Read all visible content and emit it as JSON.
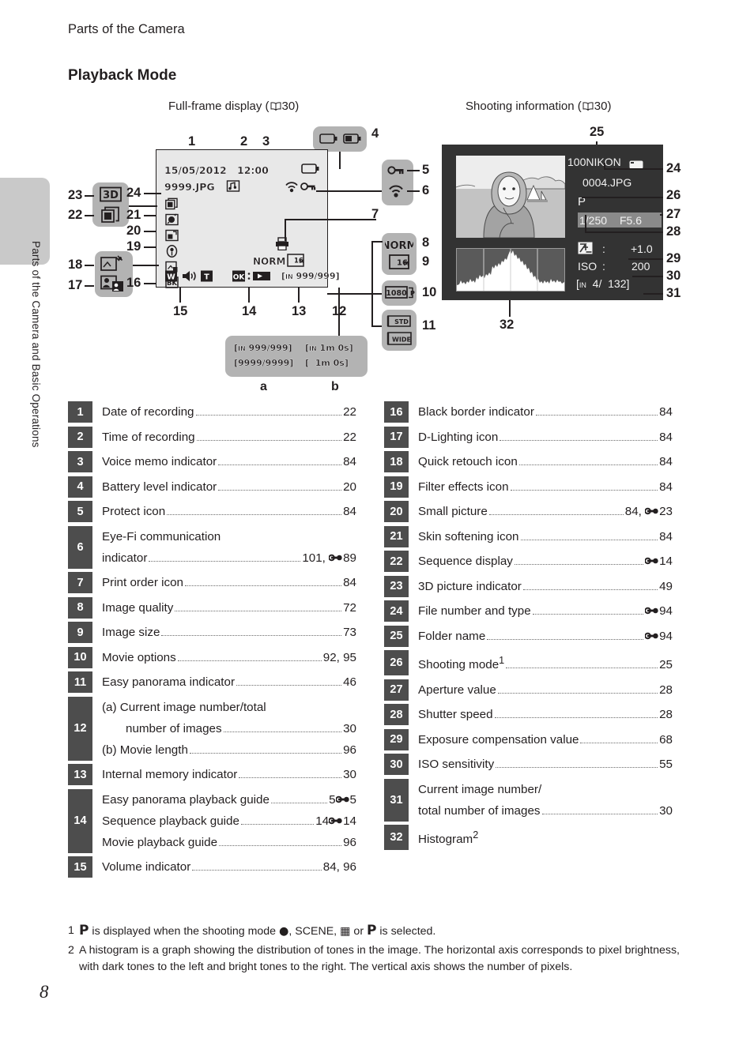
{
  "running_title": "Parts of the Camera",
  "section_title": "Playback Mode",
  "side_running_head": "Parts of the Camera and Basic Operations",
  "page_number": "8",
  "captions": {
    "left_pre": "Full-frame display (",
    "left_ref": "30",
    "left_post": ")",
    "right_pre": "Shooting information (",
    "right_ref": "30",
    "right_post": ")"
  },
  "full_frame_lcd": {
    "date": "15/05/2012",
    "time": "12:00",
    "filename": "9999.JPG",
    "voice_memo_icon": "voice-memo-icon",
    "battery_icon": "battery-full-icon",
    "eyefi_icon": "eye-fi-icon",
    "protect_icon": "protect-key-icon",
    "print_order_icon": "print-order-icon",
    "quality_label": "NORM",
    "quality_size_icon": "image-size-16m-icon",
    "volume_w": "W",
    "volume_t": "T",
    "volume_icon": "speaker-icon",
    "ok_label": "OK",
    "ok_sep": ":",
    "play_icon": "play-icon",
    "frame_counter": "[ᴵᴺ 999/999]",
    "frame_counter_text": "999/999",
    "internal_mark": "IN"
  },
  "callout_clusters": {
    "battery": {
      "icons": [
        "battery-empty-icon",
        "battery-half-icon"
      ]
    },
    "protect_eyefi": {
      "icons": [
        "protect-key-icon",
        "eye-fi-icon"
      ]
    },
    "quality": {
      "label": "NORM",
      "size_icon": "image-size-16m-icon"
    },
    "movie": {
      "label": "1080",
      "suffix": "P"
    },
    "panorama": {
      "std": "STD",
      "wide": "WIDE"
    },
    "three_d": {
      "label": "3D"
    },
    "sequence": {
      "icon": "sequence-display-icon"
    },
    "quick_retouch": {
      "icon": "quick-retouch-icon"
    },
    "d_lighting": {
      "icon": "d-lighting-icon"
    }
  },
  "lcd_left_icons": [
    {
      "num": "24",
      "name": "file-number-and-type"
    },
    {
      "num": "22",
      "name": "sequence-display-icon"
    },
    {
      "num": "21",
      "name": "skin-softening-icon"
    },
    {
      "num": "20",
      "name": "small-picture-icon"
    },
    {
      "num": "19",
      "name": "filter-effects-icon"
    },
    {
      "num": "18",
      "name": "quick-retouch-icon"
    },
    {
      "num": "16",
      "name": "black-border-icon"
    }
  ],
  "figure_numbers": [
    "1",
    "2",
    "3",
    "4",
    "5",
    "6",
    "7",
    "8",
    "9",
    "10",
    "11",
    "12",
    "13",
    "14",
    "15",
    "16",
    "17",
    "18",
    "19",
    "20",
    "21",
    "22",
    "23",
    "24",
    "25",
    "26",
    "27",
    "28",
    "29",
    "30",
    "31",
    "32"
  ],
  "ab_box": {
    "line1_left": "[ᴵᴺ 999/999]",
    "line1_right": "[ᴵᴺ 1m 0s]",
    "line2_left": "[9999/9999]",
    "line2_right": "[ 1m 0s]",
    "l1l": "999/999",
    "l1r": "1m 0s",
    "l2l": "9999/9999",
    "l2r": "1m 0s",
    "label_a": "a",
    "label_b": "b"
  },
  "shooting_info": {
    "folder_name": "100NIKON",
    "card_icon": "memory-card-icon",
    "file_name": "0004.JPG",
    "shooting_mode": "P",
    "shutter_speed": "1/250",
    "aperture": "F5.6",
    "exposure_comp_label": "exposure-compensation-icon",
    "exposure_comp_sep": ":",
    "exposure_comp_value": "+1.0",
    "iso_label": "ISO",
    "iso_sep": ":",
    "iso_value": "200",
    "counter": "[ᴵᴺ 4/ 132]",
    "counter_internal": "IN",
    "counter_current": "4/",
    "counter_total": "132]",
    "counter_open": "["
  },
  "list_left": [
    {
      "num": "1",
      "lines": [
        {
          "text": "Date of recording",
          "page": "22"
        }
      ]
    },
    {
      "num": "2",
      "lines": [
        {
          "text": "Time of recording",
          "page": "22"
        }
      ]
    },
    {
      "num": "3",
      "lines": [
        {
          "text": "Voice memo indicator",
          "page": "84"
        }
      ]
    },
    {
      "num": "4",
      "lines": [
        {
          "text": "Battery level indicator",
          "page": "20"
        }
      ]
    },
    {
      "num": "5",
      "lines": [
        {
          "text": "Protect icon",
          "page": "84"
        }
      ]
    },
    {
      "num": "6",
      "lines": [
        {
          "text": "Eye-Fi communication",
          "plain": true
        },
        {
          "text": "indicator",
          "page": "101, ",
          "eref": "89"
        }
      ]
    },
    {
      "num": "7",
      "lines": [
        {
          "text": "Print order icon",
          "page": "84"
        }
      ]
    },
    {
      "num": "8",
      "lines": [
        {
          "text": "Image quality",
          "page": "72"
        }
      ]
    },
    {
      "num": "9",
      "lines": [
        {
          "text": "Image size",
          "page": "73"
        }
      ]
    },
    {
      "num": "10",
      "lines": [
        {
          "text": "Movie options",
          "page": "92, 95"
        }
      ]
    },
    {
      "num": "11",
      "lines": [
        {
          "text": "Easy panorama indicator",
          "page": "46"
        }
      ]
    },
    {
      "num": "12",
      "lines": [
        {
          "text": "(a) Current image number/total",
          "plain": true
        },
        {
          "text": "number of images",
          "page": "30",
          "indent": true
        },
        {
          "text": "(b) Movie length",
          "page": "96"
        }
      ]
    },
    {
      "num": "13",
      "lines": [
        {
          "text": "Internal memory indicator",
          "page": "30"
        }
      ]
    },
    {
      "num": "14",
      "lines": [
        {
          "text": "Easy panorama playback guide",
          "page": "5",
          "eref": "5"
        },
        {
          "text": "Sequence playback guide",
          "page": "14",
          "eref": "14"
        },
        {
          "text": "Movie playback guide",
          "page": "96"
        }
      ]
    },
    {
      "num": "15",
      "lines": [
        {
          "text": "Volume indicator",
          "page": "84, 96"
        }
      ]
    }
  ],
  "list_right": [
    {
      "num": "16",
      "lines": [
        {
          "text": "Black border indicator",
          "page": "84"
        }
      ]
    },
    {
      "num": "17",
      "lines": [
        {
          "text": "D-Lighting icon",
          "page": "84"
        }
      ]
    },
    {
      "num": "18",
      "lines": [
        {
          "text": "Quick retouch icon",
          "page": "84"
        }
      ]
    },
    {
      "num": "19",
      "lines": [
        {
          "text": "Filter effects icon",
          "page": "84"
        }
      ]
    },
    {
      "num": "20",
      "lines": [
        {
          "text": "Small picture",
          "page": "84, ",
          "eref": "23"
        }
      ]
    },
    {
      "num": "21",
      "lines": [
        {
          "text": "Skin softening icon",
          "page": "84"
        }
      ]
    },
    {
      "num": "22",
      "lines": [
        {
          "text": "Sequence display",
          "page": "",
          "eref": "14"
        }
      ]
    },
    {
      "num": "23",
      "lines": [
        {
          "text": "3D picture indicator",
          "page": "49"
        }
      ]
    },
    {
      "num": "24",
      "lines": [
        {
          "text": "File number and type",
          "page": "",
          "eref": "94"
        }
      ]
    },
    {
      "num": "25",
      "lines": [
        {
          "text": "Folder name",
          "page": "",
          "eref": "94"
        }
      ]
    },
    {
      "num": "26",
      "lines": [
        {
          "text": "Shooting mode",
          "sup": "1",
          "page": "25"
        }
      ]
    },
    {
      "num": "27",
      "lines": [
        {
          "text": "Aperture value",
          "page": "28"
        }
      ]
    },
    {
      "num": "28",
      "lines": [
        {
          "text": "Shutter speed",
          "page": "28"
        }
      ]
    },
    {
      "num": "29",
      "lines": [
        {
          "text": "Exposure compensation value",
          "page": "68"
        }
      ]
    },
    {
      "num": "30",
      "lines": [
        {
          "text": "ISO sensitivity",
          "page": "55"
        }
      ]
    },
    {
      "num": "31",
      "lines": [
        {
          "text": "Current image number/",
          "plain": true
        },
        {
          "text": "total number of images",
          "page": "30"
        }
      ]
    },
    {
      "num": "32",
      "lines": [
        {
          "text": "Histogram",
          "sup": "2",
          "plain": true
        }
      ]
    }
  ],
  "notes": [
    {
      "n": "1",
      "pre": "",
      "body": " is displayed when the shooting mode ",
      "mid": ", SCENE, ",
      "post": " or ",
      "tail": " is selected.",
      "mode_glyph": "P"
    },
    {
      "n": "2",
      "body": "A histogram is a graph showing the distribution of tones in the image. The horizontal axis corresponds to pixel brightness, with dark tones to the left and bright tones to the right. The vertical axis shows the number of pixels."
    }
  ]
}
